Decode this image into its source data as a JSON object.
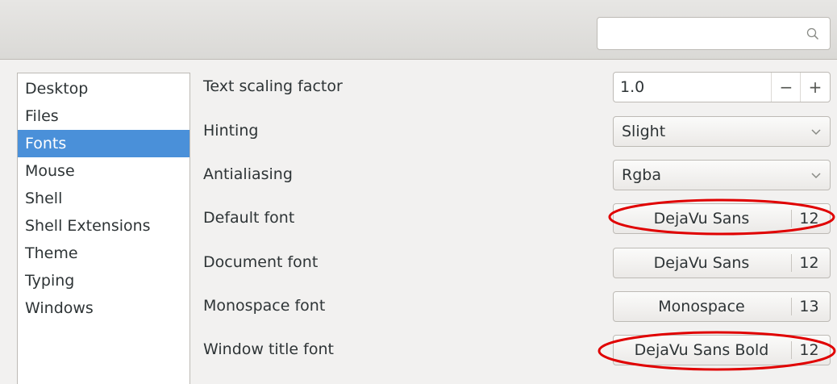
{
  "search": {
    "value": "",
    "icon": "search-icon"
  },
  "sidebar": {
    "items": [
      {
        "label": "Desktop",
        "selected": false
      },
      {
        "label": "Files",
        "selected": false
      },
      {
        "label": "Fonts",
        "selected": true
      },
      {
        "label": "Mouse",
        "selected": false
      },
      {
        "label": "Shell",
        "selected": false
      },
      {
        "label": "Shell Extensions",
        "selected": false
      },
      {
        "label": "Theme",
        "selected": false
      },
      {
        "label": "Typing",
        "selected": false
      },
      {
        "label": "Windows",
        "selected": false
      }
    ]
  },
  "fonts": {
    "text_scaling": {
      "label": "Text scaling factor",
      "value": "1.0",
      "minus": "−",
      "plus": "+"
    },
    "hinting": {
      "label": "Hinting",
      "value": "Slight"
    },
    "antialiasing": {
      "label": "Antialiasing",
      "value": "Rgba"
    },
    "default_font": {
      "label": "Default font",
      "font": "DejaVu Sans",
      "size": "12",
      "highlighted": true
    },
    "document_font": {
      "label": "Document font",
      "font": "DejaVu Sans",
      "size": "12",
      "highlighted": false
    },
    "monospace_font": {
      "label": "Monospace font",
      "font": "Monospace",
      "size": "13",
      "highlighted": false
    },
    "window_title_font": {
      "label": "Window title font",
      "font": "DejaVu Sans Bold",
      "size": "12",
      "highlighted": true
    }
  },
  "colors": {
    "selection": "#4a90d9",
    "annotation": "#e00000"
  }
}
